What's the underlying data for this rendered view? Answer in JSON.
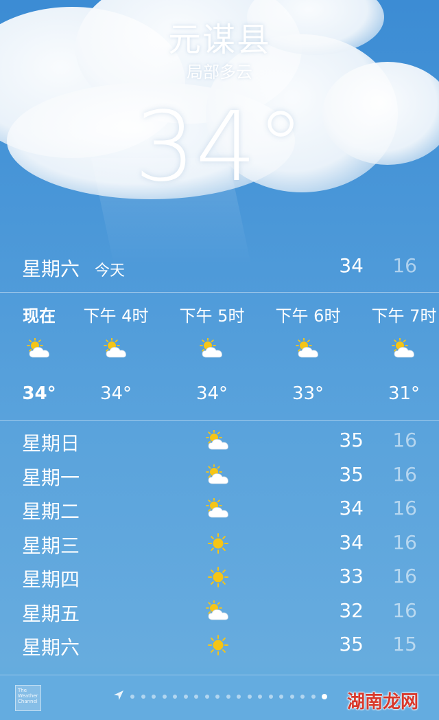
{
  "header": {
    "city": "元谋县",
    "condition": "局部多云",
    "temperature": "34°"
  },
  "today": {
    "day": "星期六",
    "tag": "今天",
    "high": "34",
    "low": "16"
  },
  "hourly": [
    {
      "label": "现在",
      "icon": "partly-cloudy-icon",
      "temp": "34°"
    },
    {
      "label": "下午 4时",
      "icon": "partly-cloudy-icon",
      "temp": "34°"
    },
    {
      "label": "下午 5时",
      "icon": "partly-cloudy-icon",
      "temp": "34°"
    },
    {
      "label": "下午 6时",
      "icon": "partly-cloudy-icon",
      "temp": "33°"
    },
    {
      "label": "下午 7时",
      "icon": "partly-cloudy-icon",
      "temp": "31°"
    }
  ],
  "daily": [
    {
      "day": "星期日",
      "icon": "partly-cloudy-icon",
      "high": "35",
      "low": "16"
    },
    {
      "day": "星期一",
      "icon": "partly-cloudy-icon",
      "high": "35",
      "low": "16"
    },
    {
      "day": "星期二",
      "icon": "partly-cloudy-icon",
      "high": "34",
      "low": "16"
    },
    {
      "day": "星期三",
      "icon": "sun-icon",
      "high": "34",
      "low": "16"
    },
    {
      "day": "星期四",
      "icon": "sun-icon",
      "high": "33",
      "low": "16"
    },
    {
      "day": "星期五",
      "icon": "partly-cloudy-icon",
      "high": "32",
      "low": "16"
    },
    {
      "day": "星期六",
      "icon": "sun-icon",
      "high": "35",
      "low": "15"
    }
  ],
  "footer": {
    "logo_text": "The Weather Channel",
    "page_count": 19,
    "active_page": 18,
    "watermark": "湖南龙网"
  },
  "colors": {
    "sun": "#f6c516",
    "cloud": "#ffffff",
    "low_temp": "rgba(255,255,255,0.55)"
  }
}
